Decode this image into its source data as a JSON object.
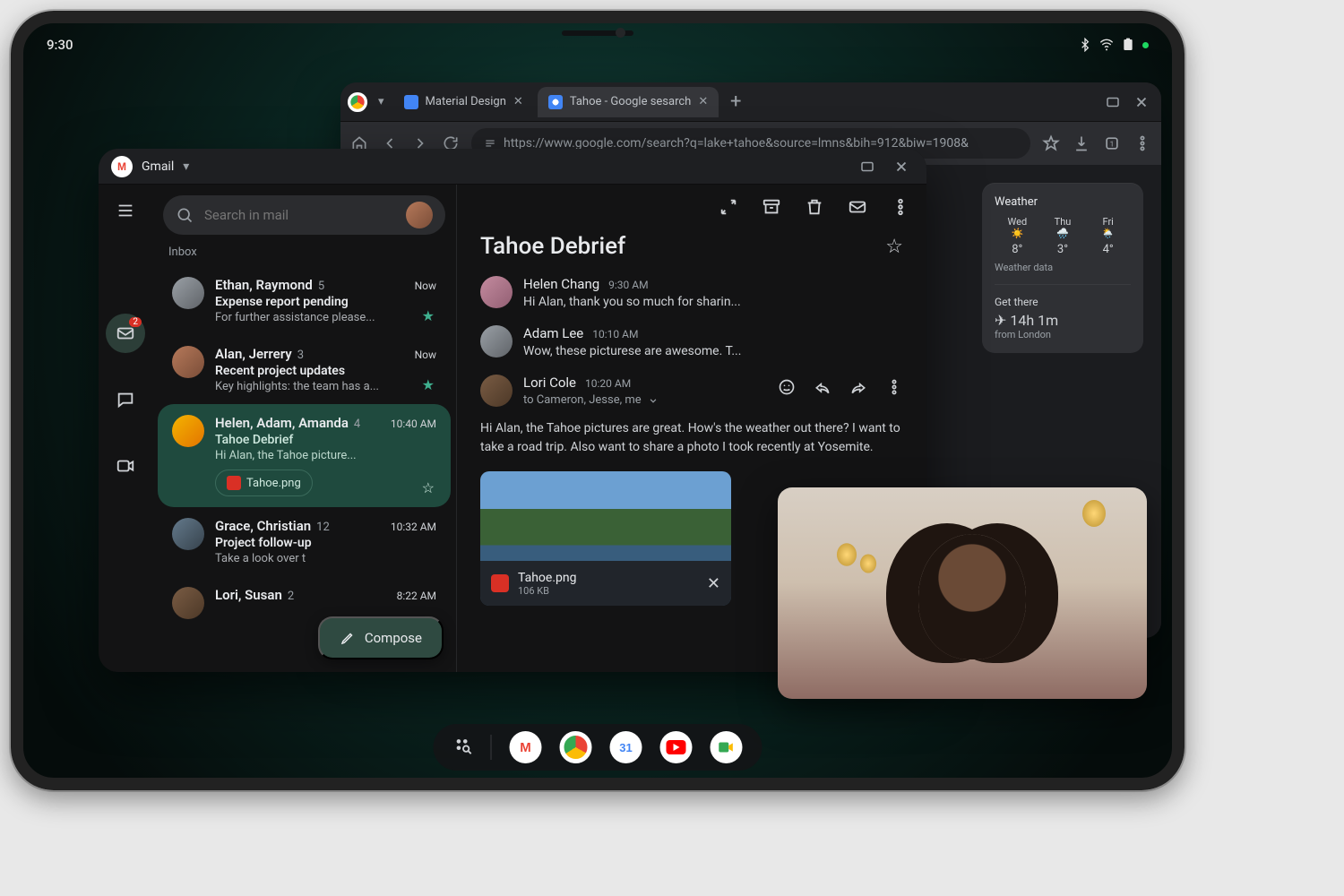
{
  "statusbar": {
    "time": "9:30"
  },
  "chrome": {
    "tabs": [
      {
        "label": "Material Design"
      },
      {
        "label": "Tahoe - Google sesarch"
      }
    ],
    "url": "https://www.google.com/search?q=lake+tahoe&source=lmns&bih=912&biw=1908&",
    "panel": {
      "weather_title": "Weather",
      "days": [
        {
          "d": "Wed",
          "t": "8°"
        },
        {
          "d": "Thu",
          "t": "3°"
        },
        {
          "d": "Fri",
          "t": "4°"
        }
      ],
      "weather_src": "Weather data",
      "get_there": "Get there",
      "duration": "14h 1m",
      "from": "from London"
    }
  },
  "gmail": {
    "title": "Gmail",
    "search_placeholder": "Search in mail",
    "rail_badge": "2",
    "section": "Inbox",
    "compose": "Compose",
    "threads": [
      {
        "senders": "Ethan, Raymond",
        "count": "5",
        "time": "Now",
        "subject": "Expense report pending",
        "snippet": "For further assistance please...",
        "starred": true
      },
      {
        "senders": "Alan, Jerrery",
        "count": "3",
        "time": "Now",
        "subject": "Recent project updates",
        "snippet": "Key highlights: the team has a...",
        "starred": true
      },
      {
        "senders": "Helen, Adam, Amanda",
        "count": "4",
        "time": "10:40 AM",
        "subject": "Tahoe Debrief",
        "snippet": "Hi Alan, the Tahoe picture...",
        "attachment": "Tahoe.png",
        "selected": true
      },
      {
        "senders": "Grace, Christian",
        "count": "12",
        "time": "10:32 AM",
        "subject": "Project follow-up",
        "snippet": "Take a look over t"
      },
      {
        "senders": "Lori, Susan",
        "count": "2",
        "time": "8:22 AM",
        "subject": "",
        "snippet": ""
      }
    ],
    "detail": {
      "subject": "Tahoe Debrief",
      "messages": [
        {
          "name": "Helen Chang",
          "time": "9:30 AM",
          "text": "Hi Alan, thank you so much for sharin..."
        },
        {
          "name": "Adam Lee",
          "time": "10:10 AM",
          "text": "Wow, these picturese are awesome. T..."
        },
        {
          "name": "Lori Cole",
          "time": "10:20 AM",
          "recipients": "to Cameron, Jesse, me"
        }
      ],
      "body": "Hi Alan, the Tahoe pictures are great. How's the weather out there? I want to take a road trip. Also want to share a photo I took recently at Yosemite.",
      "attachment": {
        "name": "Tahoe.png",
        "size": "106 KB"
      }
    }
  }
}
